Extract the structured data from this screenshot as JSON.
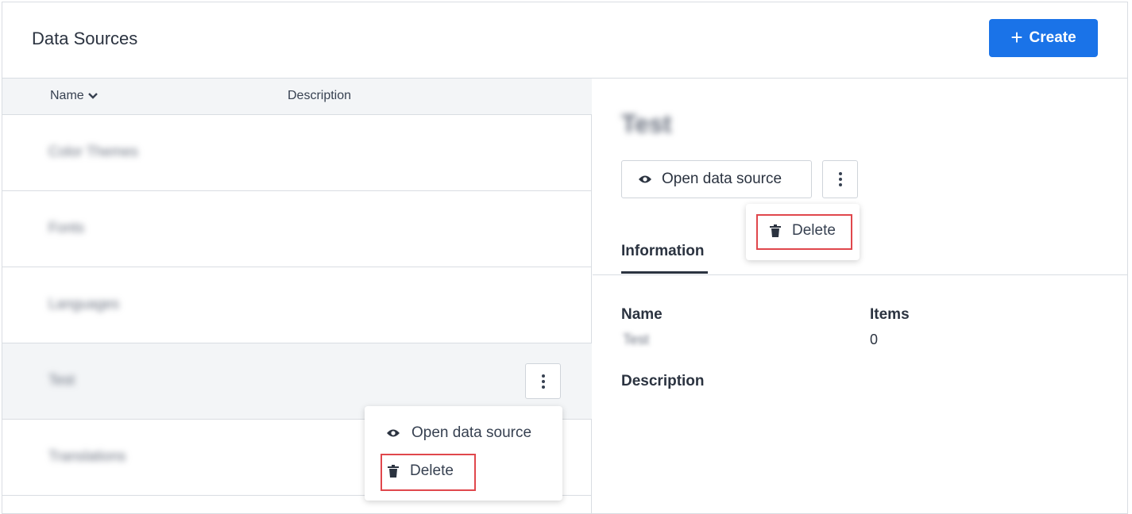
{
  "header": {
    "title": "Data Sources",
    "create_label": "Create"
  },
  "list": {
    "columns": {
      "name": "Name",
      "description": "Description"
    },
    "rows": [
      {
        "name": "Color Themes"
      },
      {
        "name": "Fonts"
      },
      {
        "name": "Languages"
      },
      {
        "name": "Test"
      },
      {
        "name": "Translations"
      }
    ],
    "context_menu": {
      "open_label": "Open data source",
      "delete_label": "Delete"
    }
  },
  "detail": {
    "title": "Test",
    "open_label": "Open data source",
    "menu": {
      "delete_label": "Delete"
    },
    "tabs": [
      {
        "label": "Information"
      }
    ],
    "fields": {
      "name_label": "Name",
      "name_value": "Test",
      "items_label": "Items",
      "items_value": "0",
      "description_label": "Description"
    }
  },
  "colors": {
    "accent": "#1a73e8",
    "highlight": "#e0474c"
  }
}
